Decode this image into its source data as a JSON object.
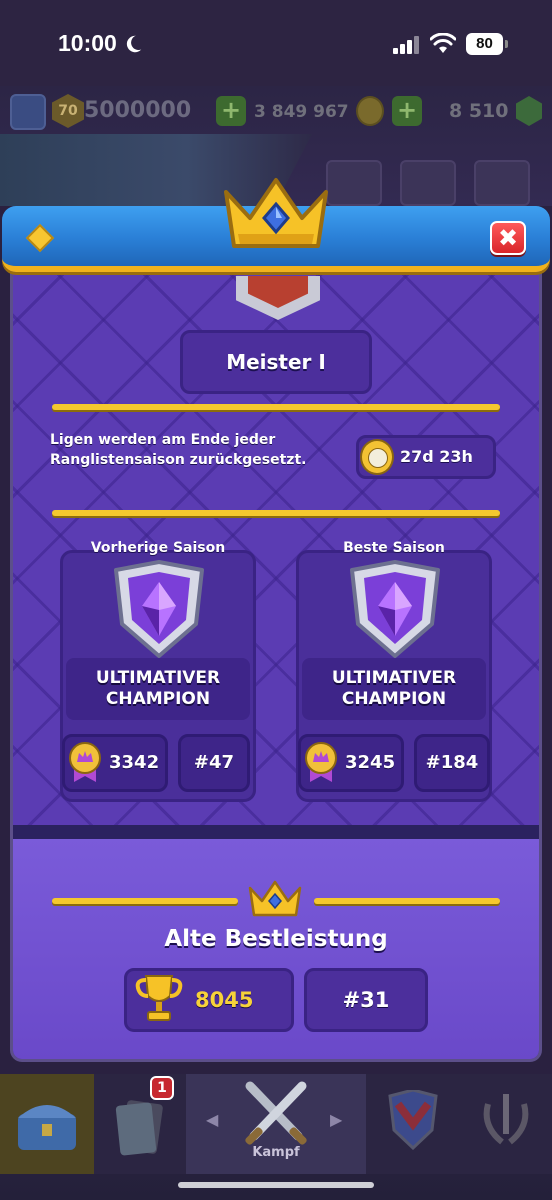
{
  "status_bar": {
    "time": "10:00",
    "battery": "80"
  },
  "hud": {
    "level": "70",
    "xp": "5000000",
    "gold": "3 849 967",
    "gems": "8 510"
  },
  "modal": {
    "league_name": "Meister I",
    "reset_text": "Ligen werden am Ende jeder Ranglistensaison zurückgesetzt.",
    "timer": "27d 23h",
    "previous_season": {
      "label": "Vorherige Saison",
      "league": "Ultimativer Champion",
      "trophies": "3342",
      "rank": "#47"
    },
    "best_season": {
      "label": "Beste Saison",
      "league": "Ultimativer Champion",
      "trophies": "3245",
      "rank": "#184"
    },
    "best_record": {
      "title": "Alte Bestleistung",
      "trophies": "8045",
      "rank": "#31"
    },
    "close_label": "✖"
  },
  "nav": {
    "cards_badge": "1",
    "battle_label": "Kampf"
  },
  "colors": {
    "accent_gold": "#f5c82e",
    "panel_purple": "#5b3cb3",
    "header_blue": "#2a7fd6",
    "close_red": "#d9252a"
  }
}
